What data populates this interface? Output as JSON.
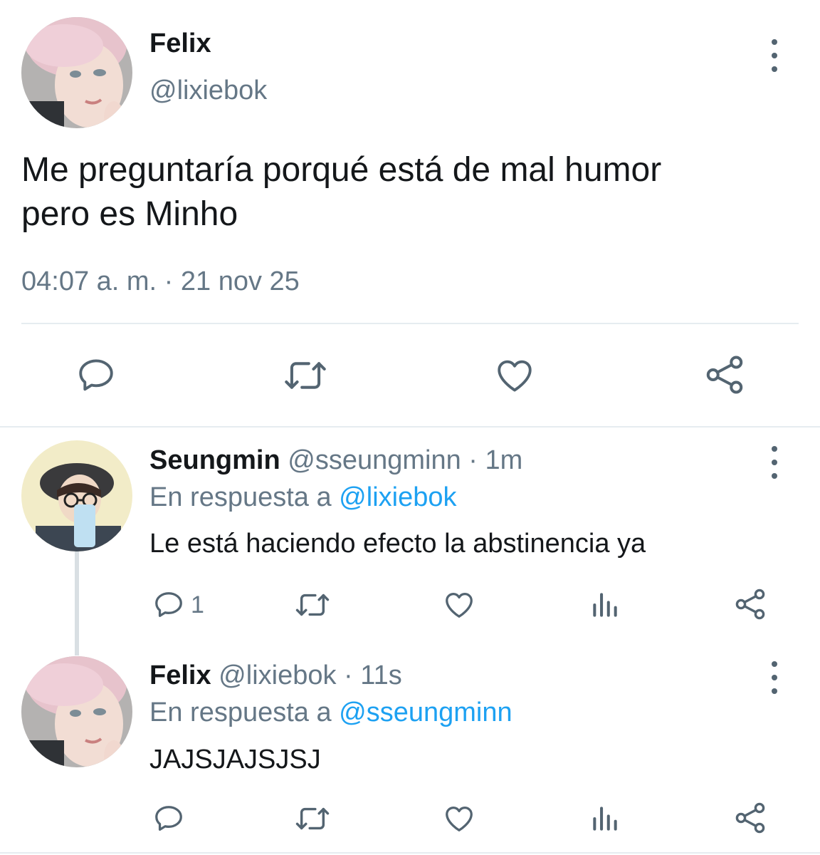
{
  "main_tweet": {
    "name": "Felix",
    "handle": "@lixiebok",
    "text_line1": "Me preguntaría porqué está de mal humor",
    "text_line2": "pero es Minho",
    "timestamp": "04:07 a. m. · 21 nov 25"
  },
  "replies": [
    {
      "name": "Seungmin",
      "handle": "@sseungminn",
      "time": "· 1m",
      "reply_prefix": "En respuesta a",
      "reply_to": "@lixiebok",
      "text": "Le está haciendo efecto la abstinencia ya",
      "reply_count": "1"
    },
    {
      "name": "Felix",
      "handle": "@lixiebok",
      "time": "· 11s",
      "reply_prefix": "En respuesta a",
      "reply_to": "@sseungminn",
      "text": "JAJSJAJSJSJ",
      "reply_count": ""
    }
  ],
  "icons": {
    "reply": "reply-icon",
    "retweet": "retweet-icon",
    "like": "heart-icon",
    "share": "share-icon",
    "views": "views-icon",
    "more": "more-vertical-icon"
  },
  "colors": {
    "text": "#14171a",
    "secondary": "#657786",
    "link": "#1da1f2",
    "divider": "#e6ecf0",
    "icon": "#536471"
  }
}
